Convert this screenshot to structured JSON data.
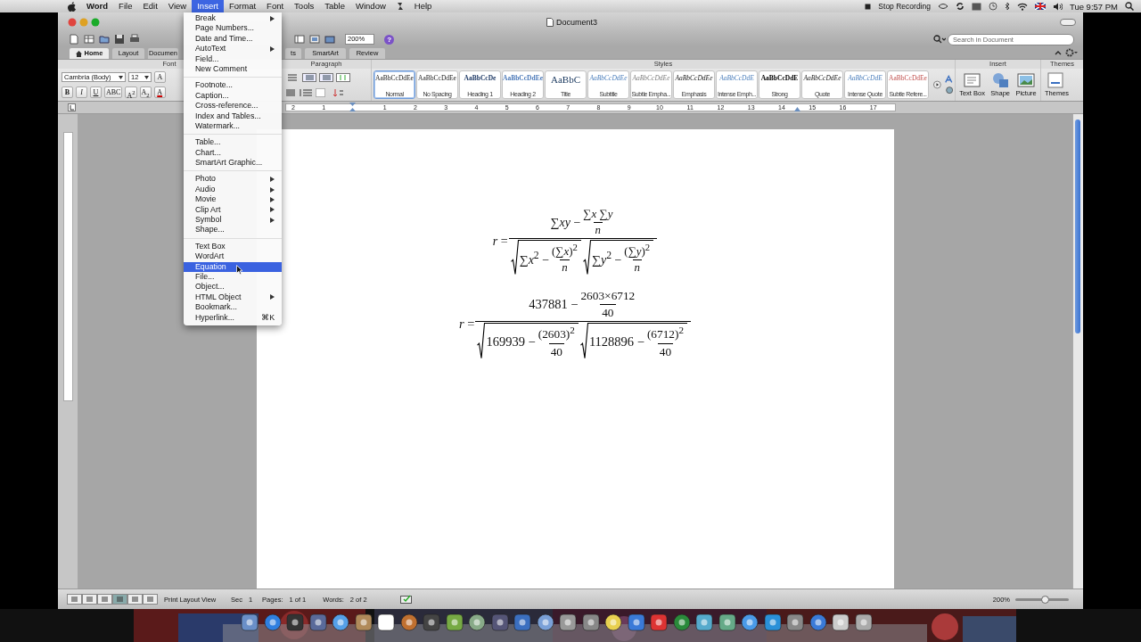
{
  "menubar": {
    "items": [
      {
        "kind": "app",
        "label": "Word",
        "selected": false
      },
      {
        "kind": "menu",
        "label": "File",
        "selected": false
      },
      {
        "kind": "menu",
        "label": "Edit",
        "selected": false
      },
      {
        "kind": "menu",
        "label": "View",
        "selected": false
      },
      {
        "kind": "menu",
        "label": "Insert",
        "selected": true
      },
      {
        "kind": "menu",
        "label": "Format",
        "selected": false
      },
      {
        "kind": "menu",
        "label": "Font",
        "selected": false
      },
      {
        "kind": "menu",
        "label": "Tools",
        "selected": false
      },
      {
        "kind": "menu",
        "label": "Table",
        "selected": false
      },
      {
        "kind": "menu",
        "label": "Window",
        "selected": false
      },
      {
        "kind": "script",
        "selected": false
      },
      {
        "kind": "menu",
        "label": "Help",
        "selected": false
      }
    ],
    "recording": "Stop Recording",
    "clock": "Tue 9:57 PM"
  },
  "insert_menu": {
    "groups": [
      [
        {
          "label": "Break",
          "submenu": true,
          "selected": false
        },
        {
          "label": "Page Numbers...",
          "submenu": false,
          "selected": false
        },
        {
          "label": "Date and Time...",
          "submenu": false,
          "selected": false
        },
        {
          "label": "AutoText",
          "submenu": true,
          "selected": false
        },
        {
          "label": "Field...",
          "submenu": false,
          "selected": false
        },
        {
          "label": "New Comment",
          "submenu": false,
          "selected": false
        }
      ],
      [
        {
          "label": "Footnote...",
          "submenu": false,
          "selected": false
        },
        {
          "label": "Caption...",
          "submenu": false,
          "selected": false
        },
        {
          "label": "Cross-reference...",
          "submenu": false,
          "selected": false
        },
        {
          "label": "Index and Tables...",
          "submenu": false,
          "selected": false
        },
        {
          "label": "Watermark...",
          "submenu": false,
          "selected": false
        }
      ],
      [
        {
          "label": "Table...",
          "submenu": false,
          "selected": false
        },
        {
          "label": "Chart...",
          "submenu": false,
          "selected": false
        },
        {
          "label": "SmartArt Graphic...",
          "submenu": false,
          "selected": false
        }
      ],
      [
        {
          "label": "Photo",
          "submenu": true,
          "selected": false
        },
        {
          "label": "Audio",
          "submenu": true,
          "selected": false
        },
        {
          "label": "Movie",
          "submenu": true,
          "selected": false
        },
        {
          "label": "Clip Art",
          "submenu": true,
          "selected": false
        },
        {
          "label": "Symbol",
          "submenu": true,
          "selected": false
        },
        {
          "label": "Shape...",
          "submenu": false,
          "selected": false
        }
      ],
      [
        {
          "label": "Text Box",
          "submenu": false,
          "selected": false
        },
        {
          "label": "WordArt",
          "submenu": false,
          "selected": false
        },
        {
          "label": "Equation",
          "submenu": false,
          "selected": true
        },
        {
          "label": "File...",
          "submenu": false,
          "selected": false
        },
        {
          "label": "Object...",
          "submenu": false,
          "selected": false
        },
        {
          "label": "HTML Object",
          "submenu": true,
          "selected": false
        },
        {
          "label": "Bookmark...",
          "submenu": false,
          "selected": false
        },
        {
          "label": "Hyperlink...",
          "submenu": false,
          "selected": false,
          "shortcut": "⌘K"
        }
      ]
    ]
  },
  "window": {
    "title": "Document3",
    "zoom": "200%",
    "help": "?",
    "search": {
      "placeholder": "Search in Document"
    }
  },
  "tabs": [
    {
      "label": "Home",
      "selected": true
    },
    {
      "label": "Layout",
      "selected": false
    },
    {
      "label": "Documen",
      "selected": false
    },
    {
      "label": "ts",
      "selected": false
    },
    {
      "label": "SmartArt",
      "selected": false
    },
    {
      "label": "Review",
      "selected": false
    }
  ],
  "ribbon": {
    "group_labels": {
      "font": "Font",
      "paragraph": "Paragraph",
      "styles": "Styles",
      "insert": "Insert",
      "themes": "Themes"
    },
    "font_name": "Cambria (Body)",
    "font_size": "12",
    "grow_font": "A",
    "format_buttons": [
      "B",
      "I",
      "U",
      "ABC",
      "A$^{2}$",
      "A$_{2}$",
      "A"
    ],
    "styles": [
      {
        "sample": "AaBbCcDdEe",
        "name": "Normal",
        "selected": true,
        "kind": "plain"
      },
      {
        "sample": "AaBbCcDdEe",
        "name": "No Spacing",
        "selected": false,
        "kind": "plain"
      },
      {
        "sample": "AaBbCcDe",
        "name": "Heading 1",
        "selected": false,
        "kind": "heading"
      },
      {
        "sample": "AaBbCcDdEe",
        "name": "Heading 2",
        "selected": false,
        "kind": "subheading"
      },
      {
        "sample": "AaBbC",
        "name": "Title",
        "selected": false,
        "kind": "title"
      },
      {
        "sample": "AaBbCcDdEe",
        "name": "Subtitle",
        "selected": false,
        "kind": "accent"
      },
      {
        "sample": "AaBbCcDdEe",
        "name": "Subtle Empha...",
        "selected": false,
        "kind": "subtle"
      },
      {
        "sample": "AaBbCcDdEe",
        "name": "Emphasis",
        "selected": false,
        "kind": "emphasis"
      },
      {
        "sample": "AaBbCcDdE",
        "name": "Intense Emph...",
        "selected": false,
        "kind": "accent"
      },
      {
        "sample": "AaBbCcDdE",
        "name": "Strong",
        "selected": false,
        "kind": "strong"
      },
      {
        "sample": "AaBbCcDdEe",
        "name": "Quote",
        "selected": false,
        "kind": "emphasis"
      },
      {
        "sample": "AaBbCcDdE",
        "name": "Intense Quote",
        "selected": false,
        "kind": "accent"
      },
      {
        "sample": "AaBbCcDdEe",
        "name": "Subtle Refere...",
        "selected": false,
        "kind": "reference"
      }
    ],
    "insert_buttons": [
      "Text Box",
      "Shape",
      "Picture"
    ],
    "themes_button": "Themes"
  },
  "ruler": {
    "left_labels": [
      "2",
      "1"
    ],
    "right_labels": [
      "1",
      "2",
      "3",
      "4",
      "5",
      "6",
      "7",
      "8",
      "9",
      "10",
      "11",
      "12",
      "13",
      "14",
      "15",
      "16",
      "17"
    ]
  },
  "equations": [
    {
      "parts": [
        {
          "kind": "text",
          "text": "*r* = ",
          "italic": false
        },
        {
          "kind": "frac",
          "num": [
            {
              "kind": "text",
              "text": "∑*xy* − ",
              "italic": false
            },
            {
              "kind": "frac",
              "num": [
                {
                  "kind": "text",
                  "text": "∑*x* ∑*y*",
                  "italic": false
                }
              ],
              "den": [
                {
                  "kind": "text",
                  "text": "n",
                  "italic": true
                }
              ]
            }
          ],
          "den": [
            {
              "kind": "sqrt",
              "body": [
                {
                  "kind": "text",
                  "text": "∑*x*$^{2}$ − ",
                  "italic": false
                },
                {
                  "kind": "frac",
                  "num": [
                    {
                      "kind": "text",
                      "text": "(∑*x*)$^{2}$",
                      "italic": false
                    }
                  ],
                  "den": [
                    {
                      "kind": "text",
                      "text": "n",
                      "italic": true
                    }
                  ]
                }
              ]
            },
            {
              "kind": "sqrt",
              "body": [
                {
                  "kind": "text",
                  "text": "∑*y*$^{2}$ − ",
                  "italic": false
                },
                {
                  "kind": "frac",
                  "num": [
                    {
                      "kind": "text",
                      "text": "(∑*y*)$^{2}$",
                      "italic": false
                    }
                  ],
                  "den": [
                    {
                      "kind": "text",
                      "text": "n",
                      "italic": true
                    }
                  ]
                }
              ]
            }
          ]
        }
      ]
    },
    {
      "parts": [
        {
          "kind": "text",
          "text": "*r* = ",
          "italic": false
        },
        {
          "kind": "frac",
          "num": [
            {
              "kind": "text",
              "text": "437881 − ",
              "italic": false
            },
            {
              "kind": "frac",
              "num": [
                {
                  "kind": "text",
                  "text": "2603×6712",
                  "italic": false
                }
              ],
              "den": [
                {
                  "kind": "text",
                  "text": "40",
                  "italic": false
                }
              ]
            }
          ],
          "den": [
            {
              "kind": "sqrt",
              "body": [
                {
                  "kind": "text",
                  "text": "169939 − ",
                  "italic": false
                },
                {
                  "kind": "frac",
                  "num": [
                    {
                      "kind": "text",
                      "text": "(2603)$^{2}$",
                      "italic": false
                    }
                  ],
                  "den": [
                    {
                      "kind": "text",
                      "text": "40",
                      "italic": false
                    }
                  ]
                }
              ]
            },
            {
              "kind": "sqrt",
              "body": [
                {
                  "kind": "text",
                  "text": "1128896 − ",
                  "italic": false
                },
                {
                  "kind": "frac",
                  "num": [
                    {
                      "kind": "text",
                      "text": "(6712)$^{2}$",
                      "italic": false
                    }
                  ],
                  "den": [
                    {
                      "kind": "text",
                      "text": "40",
                      "italic": false
                    }
                  ]
                }
              ]
            }
          ]
        }
      ]
    }
  ],
  "status_bar": {
    "view": "Print Layout View",
    "sec_label": "Sec",
    "sec": "1",
    "pages_label": "Pages:",
    "pages": "1 of 1",
    "words_label": "Words:",
    "words": "2 of 2",
    "zoom": "200%",
    "zoom_slider": {
      "level": 0.55
    }
  }
}
